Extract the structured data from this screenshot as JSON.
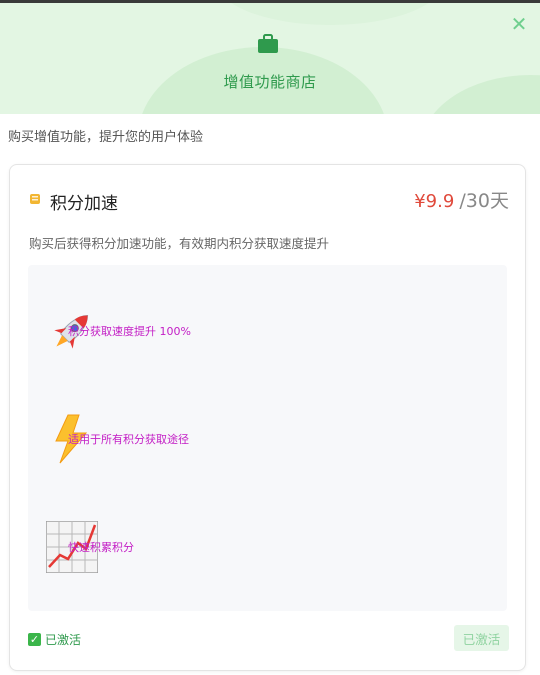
{
  "header": {
    "title": "增值功能商店",
    "close_icon": "close-icon",
    "shop_icon": "briefcase-icon",
    "accent_color": "#2f9a4d",
    "background_color": "#e3f6e3"
  },
  "subtitle": "购买增值功能，提升您的用户体验",
  "card": {
    "icon": "coin-icon",
    "title": "积分加速",
    "price_amount": "¥9.9",
    "price_unit": "/30天",
    "description": "购买后获得积分加速功能，有效期内积分获取速度提升",
    "features": [
      {
        "icon": "rocket-icon",
        "text": "积分获取速度提升 100%"
      },
      {
        "icon": "lightning-icon",
        "text": "适用于所有积分获取途径"
      },
      {
        "icon": "chart-increasing-icon",
        "text": "快速积累积分"
      }
    ],
    "status_icon": "check-mark-icon",
    "status_text": "已激活",
    "button_label": "已激活",
    "price_color": "#e04a3c"
  }
}
